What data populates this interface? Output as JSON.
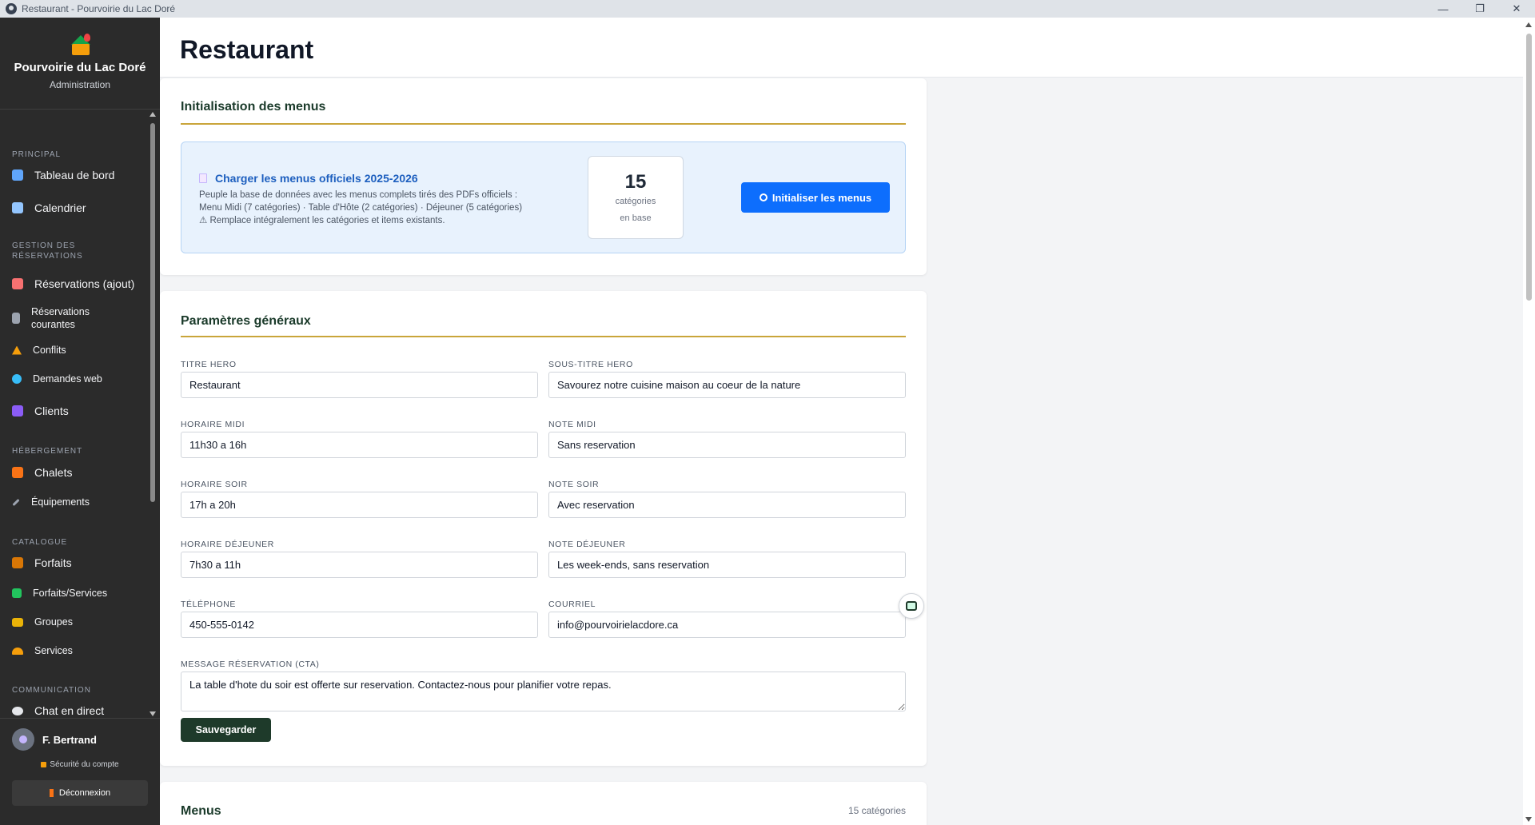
{
  "window": {
    "title": "Restaurant - Pourvoirie du Lac Doré",
    "minimize": "—",
    "restore": "❐",
    "close": "✕"
  },
  "brand": {
    "name": "Pourvoirie du Lac Doré",
    "subtitle": "Administration"
  },
  "sidebar": {
    "sections": {
      "principal": "PRINCIPAL",
      "reservations": "GESTION DES RÉSERVATIONS",
      "hebergement": "HÉBERGEMENT",
      "catalogue": "CATALOGUE",
      "communication": "COMMUNICATION"
    },
    "items": [
      {
        "label": "Tableau de bord",
        "icon": "chart-icon",
        "color": "#60a5fa"
      },
      {
        "label": "Calendrier",
        "icon": "calendar-icon",
        "color": "#93c5fd"
      },
      {
        "label": "Réservations (ajout)",
        "icon": "clipboard-icon",
        "color": "#f87171"
      },
      {
        "label": "Réservations courantes",
        "icon": "document-icon",
        "color": "#9ca3af"
      },
      {
        "label": "Conflits",
        "icon": "warning-icon",
        "color": "#f59e0b"
      },
      {
        "label": "Demandes web",
        "icon": "globe-icon",
        "color": "#38bdf8"
      },
      {
        "label": "Clients",
        "icon": "users-icon",
        "color": "#8b5cf6"
      },
      {
        "label": "Chalets",
        "icon": "house-icon",
        "color": "#f97316"
      },
      {
        "label": "Équipements",
        "icon": "wrench-icon",
        "color": "#9ca3af"
      },
      {
        "label": "Forfaits",
        "icon": "package-icon",
        "color": "#d97706"
      },
      {
        "label": "Forfaits/Services",
        "icon": "puzzle-icon",
        "color": "#22c55e"
      },
      {
        "label": "Groupes",
        "icon": "folder-icon",
        "color": "#eab308"
      },
      {
        "label": "Services",
        "icon": "bell-icon",
        "color": "#f59e0b"
      },
      {
        "label": "Chat en direct",
        "icon": "chat-icon",
        "color": "#e5e7eb"
      }
    ]
  },
  "user": {
    "name": "F. Bertrand",
    "security": "Sécurité du compte",
    "logout": "Déconnexion"
  },
  "page": {
    "title": "Restaurant"
  },
  "init_menus": {
    "section_title": "Initialisation des menus",
    "box_title": "Charger les menus officiels 2025-2026",
    "desc_line1": "Peuple la base de données avec les menus complets tirés des PDFs officiels :",
    "desc_line2": "Menu Midi (7 catégories) · Table d'Hôte (2 catégories) · Déjeuner (5 catégories)",
    "desc_line3": "⚠ Remplace intégralement les catégories et items existants.",
    "count": "15",
    "count_label1": "catégories",
    "count_label2": "en base",
    "button": "Initialiser les menus"
  },
  "general": {
    "section_title": "Paramètres généraux",
    "fields": {
      "titre_hero": {
        "label": "TITRE HERO",
        "value": "Restaurant"
      },
      "sous_titre_hero": {
        "label": "SOUS-TITRE HERO",
        "value": "Savourez notre cuisine maison au coeur de la nature"
      },
      "horaire_midi": {
        "label": "HORAIRE MIDI",
        "value": "11h30 a 16h"
      },
      "note_midi": {
        "label": "NOTE MIDI",
        "value": "Sans reservation"
      },
      "horaire_soir": {
        "label": "HORAIRE SOIR",
        "value": "17h a 20h"
      },
      "note_soir": {
        "label": "NOTE SOIR",
        "value": "Avec reservation"
      },
      "horaire_dejeuner": {
        "label": "HORAIRE DÉJEUNER",
        "value": "7h30 a 11h"
      },
      "note_dejeuner": {
        "label": "NOTE DÉJEUNER",
        "value": "Les week-ends, sans reservation"
      },
      "telephone": {
        "label": "TÉLÉPHONE",
        "value": "450-555-0142"
      },
      "courriel": {
        "label": "COURRIEL",
        "value": "info@pourvoirielacdore.ca"
      },
      "message": {
        "label": "MESSAGE RÉSERVATION (CTA)",
        "value": "La table d'hote du soir est offerte sur reservation. Contactez-nous pour planifier votre repas."
      }
    },
    "save_button": "Sauvegarder"
  },
  "menus": {
    "section_title": "Menus",
    "count": "15 catégories"
  }
}
